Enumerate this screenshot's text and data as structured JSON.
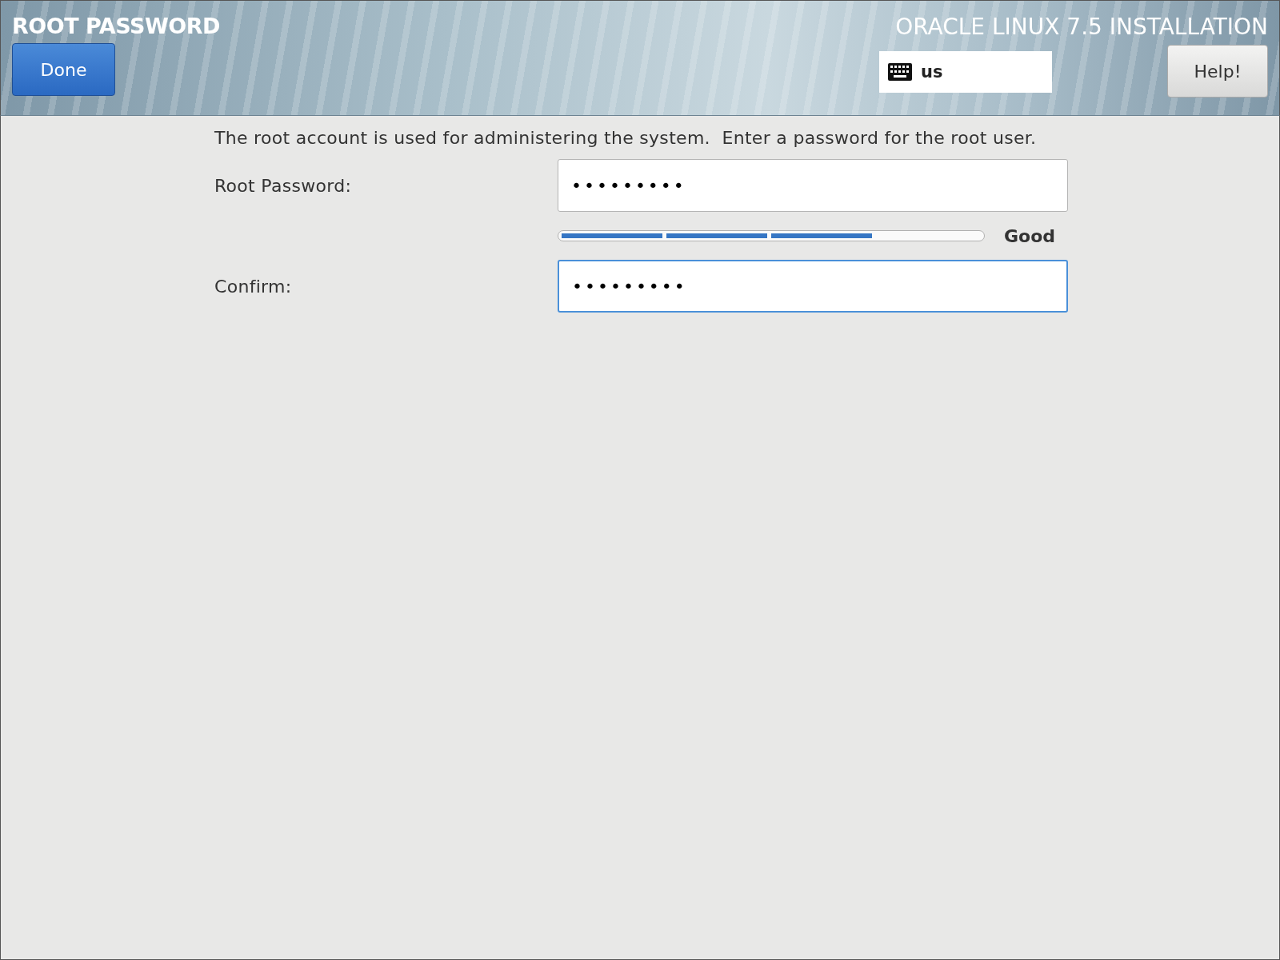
{
  "header": {
    "title": "ROOT PASSWORD",
    "done_button": "Done",
    "product": "ORACLE LINUX 7.5 INSTALLATION",
    "keyboard_layout": "us",
    "help_button": "Help!"
  },
  "description": "The root account is used for administering the system.  Enter a password for the root user.",
  "fields": [
    {
      "label": "Root Password:",
      "value": "•••••••••",
      "focused": false
    },
    {
      "label": "Confirm:",
      "value": "•••••••••",
      "focused": true
    }
  ],
  "strength": {
    "level": 0.75,
    "reading": "Good"
  }
}
